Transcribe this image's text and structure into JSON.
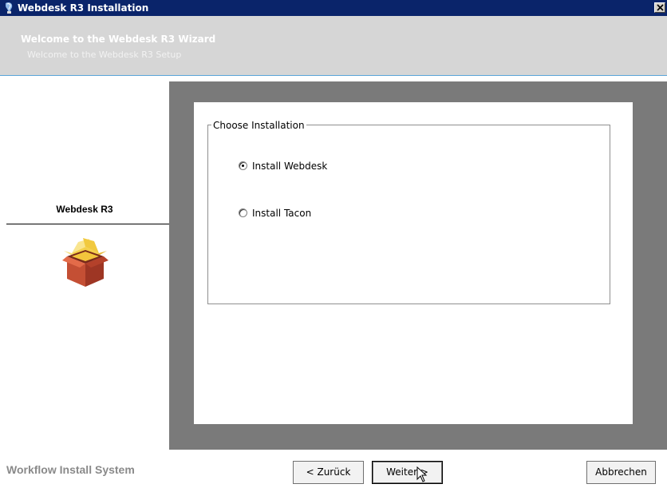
{
  "window": {
    "title": "Webdesk R3 Installation",
    "close_label": "✕"
  },
  "header": {
    "title": "Welcome to the Webdesk R3 Wizard",
    "subtitle": "Welcome to the Webdesk R3 Setup"
  },
  "sidebar": {
    "product_name": "Webdesk R3",
    "icon": "package-box-icon"
  },
  "content": {
    "group_label": "Choose Installation",
    "options": [
      {
        "label": "Install Webdesk",
        "selected": true
      },
      {
        "label": "Install Tacon",
        "selected": false
      }
    ]
  },
  "footer": {
    "brand": "Workflow Install System",
    "back_label": "< Zurück",
    "next_label": "Weiter >",
    "cancel_label": "Abbrechen"
  },
  "colors": {
    "titlebar": "#0a246a",
    "header": "#d6d6d6",
    "frame": "#7a7a7a",
    "accent_line": "#5aa4d9"
  }
}
